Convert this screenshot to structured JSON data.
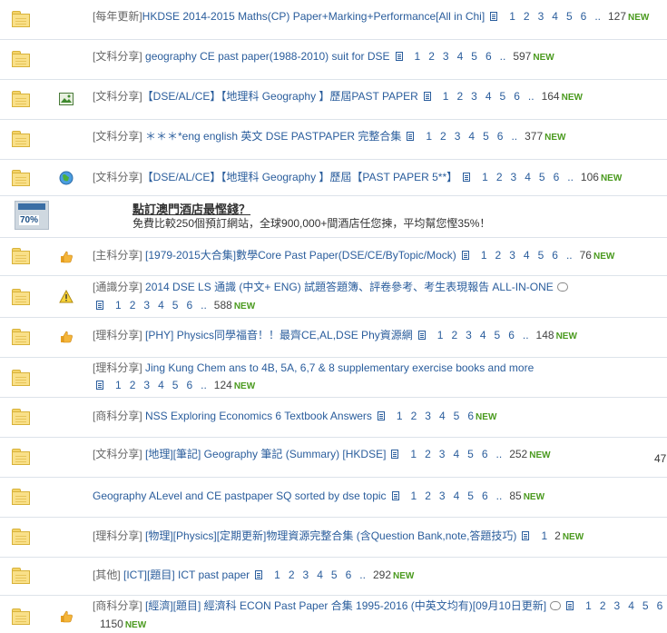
{
  "threads": [
    {
      "icon": "",
      "cat": "[每年更新]",
      "title": "HKDSE 2014-2015 Maths(CP) Paper+Marking+Performance[All in Chi]",
      "pages": [
        "1",
        "2",
        "3",
        "4",
        "5",
        "6"
      ],
      "count": "127",
      "new": "NEW"
    },
    {
      "icon": "",
      "cat": "[文科分享]",
      "title": "geography CE past paper(1988-2010) suit for DSE",
      "pages": [
        "1",
        "2",
        "3",
        "4",
        "5",
        "6"
      ],
      "count": "597",
      "new": "NEW"
    },
    {
      "icon": "image",
      "cat": "[文科分享]",
      "title": "【DSE/AL/CE】【地理科 Geography 】歷屆PAST PAPER",
      "pages": [
        "1",
        "2",
        "3",
        "4",
        "5",
        "6"
      ],
      "count": "164",
      "new": "NEW"
    },
    {
      "icon": "",
      "cat": "[文科分享]",
      "title": "＊＊＊*eng english 英文 DSE PASTPAPER 完整合集",
      "pages": [
        "1",
        "2",
        "3",
        "4",
        "5",
        "6"
      ],
      "count": "377",
      "new": "NEW"
    },
    {
      "icon": "globe",
      "cat": "[文科分享]",
      "title": "【DSE/AL/CE】【地理科 Geography 】歷屆【PAST PAPER 5**】",
      "pages": [
        "1",
        "2",
        "3",
        "4",
        "5",
        "6"
      ],
      "count": "106",
      "new": "NEW"
    },
    {
      "icon": "thumb",
      "cat": "[主科分享]",
      "title": "[1979-2015大合集]數學Core Past Paper(DSE/CE/ByTopic/Mock)",
      "pages": [
        "1",
        "2",
        "3",
        "4",
        "5",
        "6"
      ],
      "count": "76",
      "new": "NEW"
    },
    {
      "icon": "warn",
      "cat": "[通識分享]",
      "title": "2014 DSE LS 通識 (中文+ ENG) 試題答題簿、評卷參考、考生表現報告 ALL-IN-ONE",
      "pages": [
        "1",
        "2",
        "3",
        "4",
        "5",
        "6"
      ],
      "count": "588",
      "new": "NEW"
    },
    {
      "icon": "thumb",
      "cat": "[理科分享]",
      "title": "[PHY] Physics同學福音！！最齊CE,AL,DSE Phy資源網",
      "pages": [
        "1",
        "2",
        "3",
        "4",
        "5",
        "6"
      ],
      "count": "148",
      "new": "NEW"
    },
    {
      "icon": "",
      "cat": "[理科分享]",
      "title": "Jing Kung Chem ans to 4B, 5A, 6,7 & 8 supplementary exercise books and more",
      "pages": [
        "1",
        "2",
        "3",
        "4",
        "5",
        "6"
      ],
      "count": "124",
      "new": "NEW"
    },
    {
      "icon": "",
      "cat": "[商科分享]",
      "title": "NSS Exploring Economics 6 Textbook Answers",
      "pages": [
        "1",
        "2",
        "3",
        "4",
        "5",
        "6"
      ],
      "count": "",
      "new": "NEW"
    },
    {
      "icon": "",
      "cat": "[文科分享]",
      "title": "[地理][筆記] Geography 筆記 (Summary) [HKDSE]",
      "pages": [
        "1",
        "2",
        "3",
        "4",
        "5",
        "6"
      ],
      "count": "252",
      "new": "NEW"
    },
    {
      "icon": "",
      "cat": "",
      "title": "Geography ALevel and CE pastpaper SQ sorted by dse topic",
      "pages": [
        "1",
        "2",
        "3",
        "4",
        "5",
        "6"
      ],
      "count": "85",
      "new": "NEW"
    },
    {
      "icon": "",
      "cat": "[理科分享]",
      "title": "[物理][Physics][定期更新]物理資源完整合集 (含Question Bank,note,答題技巧)",
      "pages": [
        "1"
      ],
      "count": "2",
      "new": "NEW"
    },
    {
      "icon": "",
      "cat": "[其他]",
      "title": "[ICT][題目] ICT past paper",
      "pages": [
        "1",
        "2",
        "3",
        "4",
        "5",
        "6"
      ],
      "count": "292",
      "new": "NEW"
    },
    {
      "icon": "thumb",
      "cat": "[商科分享]",
      "title": "[經濟][題目] 經濟科 ECON Past Paper 合集 1995-2016 (中英文均有)[09月10日更新]",
      "pages": [
        "1",
        "2",
        "3",
        "4",
        "5",
        "6"
      ],
      "count": "1150",
      "new": "NEW"
    }
  ],
  "ad": {
    "title": "點訂澳門酒店最慳錢？",
    "desc": "免費比較250個預訂網站，全球900,000+間酒店任您揀，平均幫您慳35%！",
    "badge": "70%"
  },
  "side_number": "47"
}
